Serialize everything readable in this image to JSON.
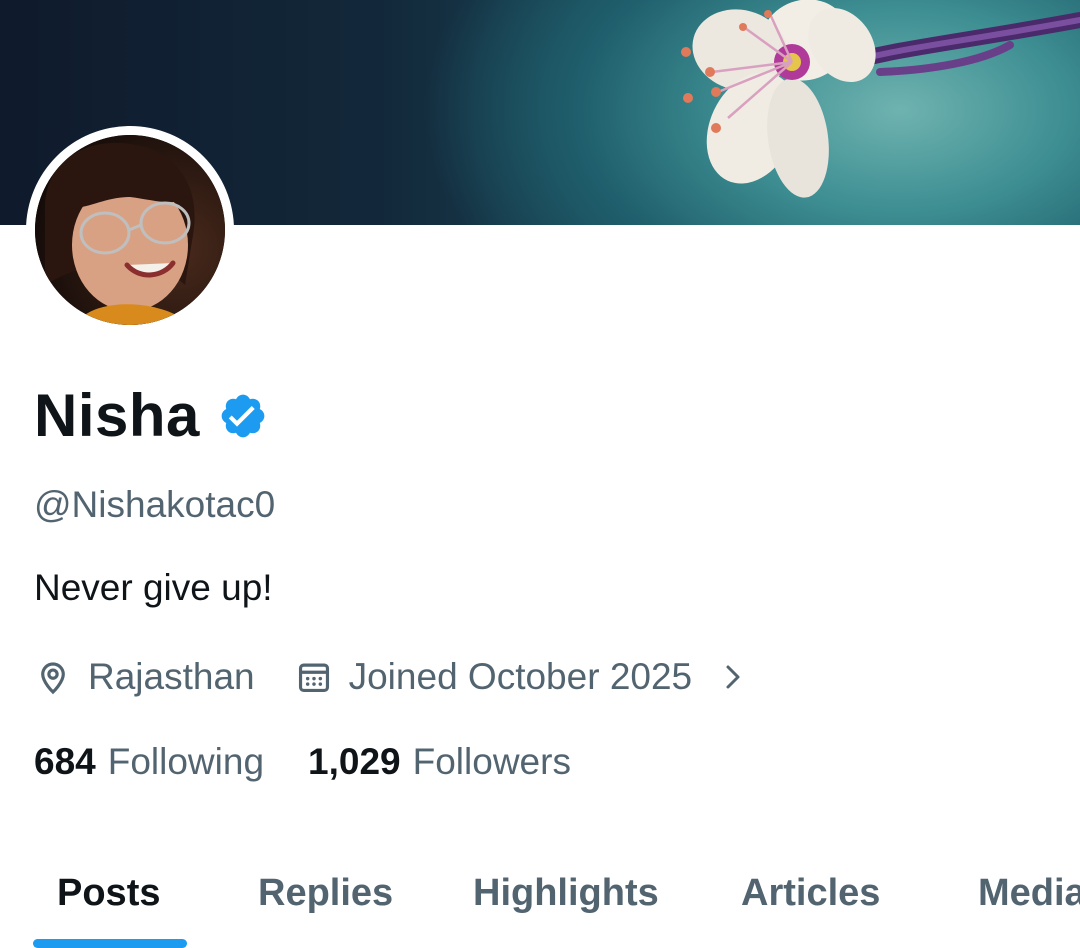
{
  "profile": {
    "display_name": "Nisha",
    "verified": true,
    "handle": "@Nishakotac0",
    "bio": "Never give up!",
    "location": "Rajasthan",
    "joined": "Joined October 2025"
  },
  "stats": {
    "following_count": "684",
    "following_label": "Following",
    "followers_count": "1,029",
    "followers_label": "Followers"
  },
  "tabs": [
    {
      "label": "Posts",
      "active": true
    },
    {
      "label": "Replies",
      "active": false
    },
    {
      "label": "Highlights",
      "active": false
    },
    {
      "label": "Articles",
      "active": false
    },
    {
      "label": "Media",
      "active": false
    }
  ],
  "icons": {
    "location": "location-pin-icon",
    "calendar": "calendar-icon",
    "chevron": "chevron-right-icon",
    "verified": "verified-badge-icon"
  },
  "colors": {
    "accent": "#1d9bf0",
    "primary_text": "#0f1419",
    "secondary_text": "#536471",
    "background": "#ffffff"
  }
}
